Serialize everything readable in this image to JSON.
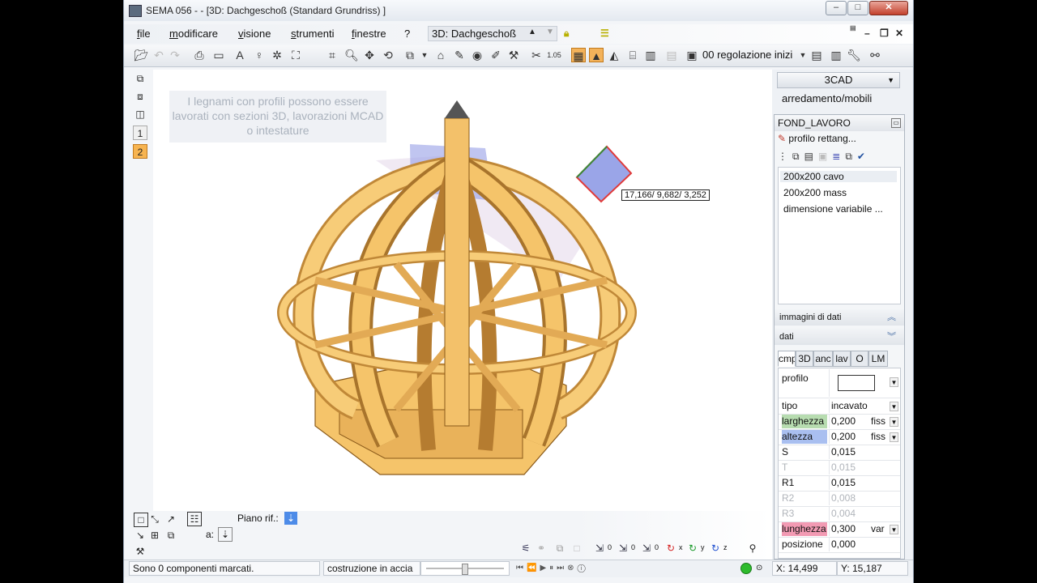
{
  "window": {
    "title": "SEMA  056 -   - [3D: Dachgeschoß (Standard Grundriss) ]"
  },
  "menu": {
    "items": [
      "file",
      "modificare",
      "visione",
      "strumenti",
      "finestre",
      "?"
    ],
    "view_name": "3D: Dachgeschoß"
  },
  "toolbar": {
    "regolazione": "00 regolazione inizi"
  },
  "left_tools": {
    "level1": "1",
    "level2": "2"
  },
  "canvas": {
    "tooltip": "I legnami con profili possono essere lavorati con sezioni 3D, lavorazioni MCAD o intestature",
    "coordinates": "17,166/ 9,682/ 3,252"
  },
  "bottom_tools": {
    "piano_label": "Piano rif.:",
    "a_label": "a:",
    "axis_labels": [
      "0",
      "0",
      "0",
      "x",
      "y",
      "z"
    ]
  },
  "status": {
    "message": "Sono 0 componenti marcati.",
    "mode": "costruzione in accia",
    "x": "X: 14,499",
    "y": "Y: 15,187"
  },
  "right_panel": {
    "cad_mode": "3CAD",
    "category": "arredamento/mobili",
    "fondo_title": "FOND_LAVORO",
    "profile_name": "profilo rettang...",
    "profiles": [
      "200x200 cavo",
      "200x200 mass",
      "dimensione variabile ..."
    ],
    "sect_images": "immagini di dati",
    "sect_data": "dati",
    "tabs": [
      "cmp",
      "3D",
      "anc",
      "lav",
      "O",
      "LM"
    ],
    "props": [
      {
        "key": "profilo",
        "value": "",
        "color": ""
      },
      {
        "key": "tipo",
        "value": "incavato",
        "unit": "",
        "color": ""
      },
      {
        "key": "larghezza",
        "value": "0,200",
        "unit": "fiss",
        "color": "#b7dcb0"
      },
      {
        "key": "altezza",
        "value": "0,200",
        "unit": "fiss",
        "color": "#a9bff0"
      },
      {
        "key": "S",
        "value": "0,015",
        "unit": "",
        "color": ""
      },
      {
        "key": "T",
        "value": "0,015",
        "unit": "",
        "color": "",
        "dim": true
      },
      {
        "key": "R1",
        "value": "0,015",
        "unit": "",
        "color": ""
      },
      {
        "key": "R2",
        "value": "0,008",
        "unit": "",
        "color": "",
        "dim": true
      },
      {
        "key": "R3",
        "value": "0,004",
        "unit": "",
        "color": "",
        "dim": true
      },
      {
        "key": "lunghezza",
        "value": "0,300",
        "unit": "var",
        "color": "#f29ab3"
      },
      {
        "key": "posizione",
        "value": "0,000",
        "unit": "",
        "color": ""
      }
    ]
  }
}
